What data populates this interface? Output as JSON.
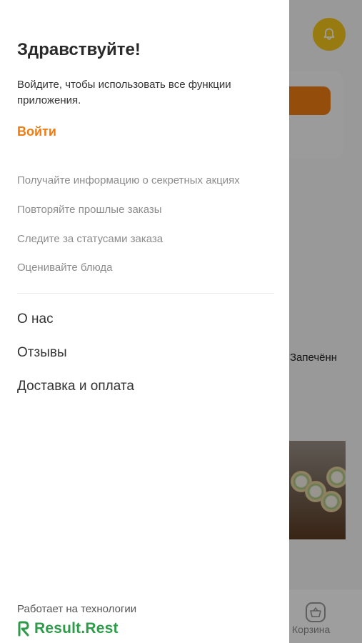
{
  "drawer": {
    "greeting": "Здравствуйте!",
    "subtitle": "Войдите, чтобы использовать все функции приложения.",
    "login_label": "Войти",
    "benefits": [
      "Получайте информацию о секретных акциях",
      "Повторяйте прошлые заказы",
      "Следите за статусами заказа",
      "Оценивайте блюда"
    ],
    "menu": [
      "О нас",
      "Отзывы",
      "Доставка и оплата"
    ],
    "footer": {
      "powered_text": "Работает на технологии",
      "brand_name": "Result.Rest"
    }
  },
  "background": {
    "product_name": "Запечённ",
    "cart_label": "Корзина"
  },
  "colors": {
    "accent": "#f07c12",
    "brand_green": "#2f9a4a",
    "bell_yellow": "#f4c61a"
  },
  "icons": {
    "bell": "bell-icon",
    "cart": "basket-icon",
    "brand_logo": "result-rest-logo-icon"
  }
}
